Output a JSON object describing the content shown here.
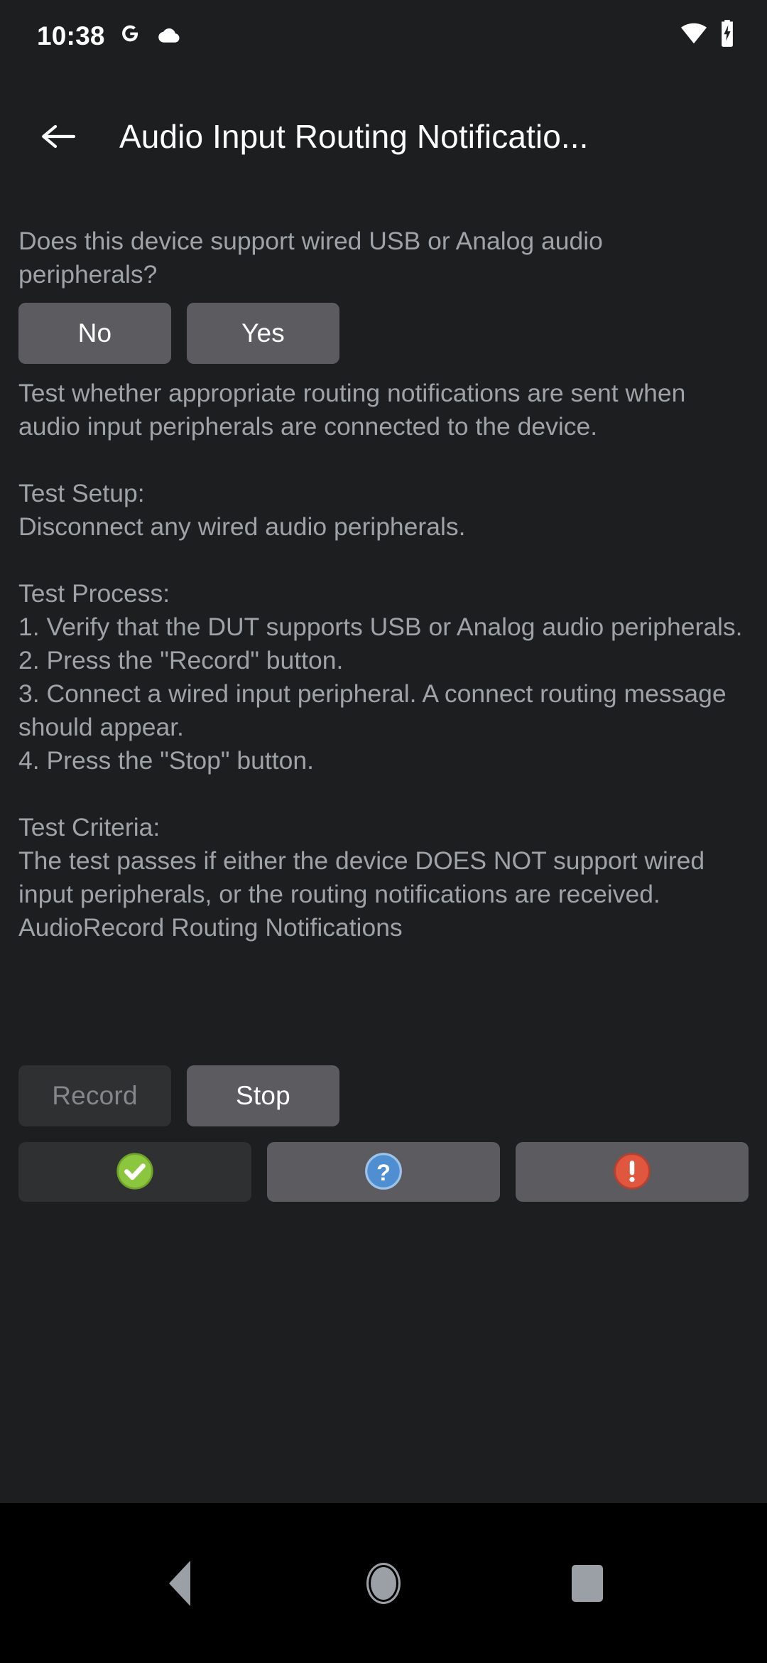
{
  "status_bar": {
    "clock": "10:38",
    "left_icons": [
      "google-g-icon",
      "cloud-icon"
    ],
    "right_icons": [
      "wifi-icon",
      "battery-charging-icon"
    ]
  },
  "app_bar": {
    "back_icon": "back-arrow-icon",
    "title": "Audio Input Routing Notificatio..."
  },
  "content": {
    "question": "Does this device support wired USB or Analog audio peripherals?",
    "answer_buttons": [
      {
        "label": "No",
        "enabled": true
      },
      {
        "label": "Yes",
        "enabled": true
      }
    ],
    "description": "Test whether appropriate routing notifications are sent when audio input peripherals are connected to the device.",
    "instructions": "Test Setup:\nDisconnect any wired audio peripherals.\n\nTest Process:\n1. Verify that the DUT supports USB or Analog audio peripherals.\n2. Press the \"Record\" button.\n3. Connect a wired input peripheral. A connect routing message should appear.\n4. Press the \"Stop\" button.\n\nTest Criteria:\nThe test passes if either the device DOES NOT support wired input peripherals, or the routing notifications are received.",
    "status_line": "AudioRecord Routing Notifications",
    "transport_buttons": [
      {
        "label": "Record",
        "enabled": false
      },
      {
        "label": "Stop",
        "enabled": true
      }
    ],
    "verdict_buttons": [
      {
        "icon": "pass-check-icon",
        "enabled": false,
        "color": "#8cc63e"
      },
      {
        "icon": "info-question-icon",
        "enabled": true,
        "color": "#4f8fd1"
      },
      {
        "icon": "fail-exclamation-icon",
        "enabled": true,
        "color": "#e0563f"
      }
    ]
  },
  "nav_bar": {
    "keys": [
      "back-triangle-icon",
      "home-circle-icon",
      "recents-square-icon"
    ]
  }
}
